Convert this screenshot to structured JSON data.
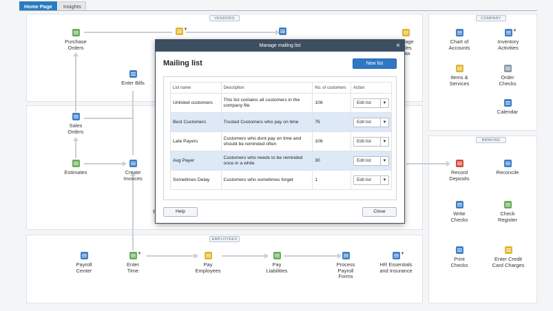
{
  "tabs": [
    "Home Page",
    "Insights"
  ],
  "sections": {
    "vendors": "VENDORS",
    "company": "COMPANY",
    "banking": "BANKING",
    "employees": "EMPLOYEES"
  },
  "nodes": {
    "purchase_orders": "Purchase\nOrders",
    "enter_bills": "Enter Bills",
    "manage_sales_tax": "nage\nales\nTax",
    "sales_orders": "Sales\nOrders",
    "estimates": "Estimates",
    "create_invoices": "Create\nInvoices",
    "partial_s": "S",
    "chart_of_accounts": "Chart of\nAccounts",
    "inventory_activities": "Inventory\nActivities",
    "items_services": "Items &\nServices",
    "order_checks": "Order\nChecks",
    "calendar": "Calendar",
    "record_deposits": "Record\nDeposits",
    "reconcile": "Reconcile",
    "write_checks": "Write\nChecks",
    "check_register": "Check\nRegister",
    "print_checks": "Print\nChecks",
    "enter_credit_card_charges": "Enter Credit\nCard Charges",
    "payroll_center": "Payroll\nCenter",
    "enter_time": "Enter\nTime",
    "pay_employees": "Pay\nEmployees",
    "pay_liabilities": "Pay\nLiabilities",
    "process_payroll_forms": "Process\nPayroll\nForms",
    "hr_essentials": "HR Essentials\nand Insurance"
  },
  "dialog": {
    "window_title": "Manage mailing list",
    "close_glyph": "×",
    "heading": "Mailing list",
    "new_list_label": "New list",
    "columns": [
      "List name",
      "Description",
      "No. of customers",
      "Action"
    ],
    "rows": [
      {
        "name": "Unlisted customers",
        "description": "This list contains all customers in the company file",
        "count": "106",
        "action": "Edit list",
        "selected": false
      },
      {
        "name": "Best Customers",
        "description": "Trusted Customers who pay on time",
        "count": "75",
        "action": "Edit list",
        "selected": true
      },
      {
        "name": "Late Payers",
        "description": "Customers who dont pay on time and should be reminded often",
        "count": "106",
        "action": "Edit list",
        "selected": false
      },
      {
        "name": "Avg Payer",
        "description": "Customers who needs to be reminded once in a while",
        "count": "30",
        "action": "Edit list",
        "selected": true
      },
      {
        "name": "Sometimes Delay",
        "description": "Customers who sometimes forget",
        "count": "1",
        "action": "Edit list",
        "selected": false
      }
    ],
    "help_label": "Help",
    "close_label": "Close"
  },
  "colors": {
    "accent": "#2b7bc0",
    "dialog_title_bg": "#3e4e61",
    "selected_row": "#dde9f7"
  }
}
